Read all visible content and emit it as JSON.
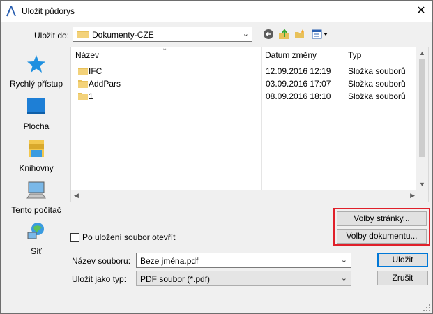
{
  "window": {
    "title": "Uložit půdorys",
    "close_glyph": "✕"
  },
  "toolbar": {
    "save_in_label": "Uložit do:",
    "save_in_value": "Dokumenty-CZE",
    "icons": [
      "back-icon",
      "up-folder-icon",
      "new-folder-icon",
      "view-menu-icon"
    ]
  },
  "places": [
    {
      "label": "Rychlý přístup",
      "icon": "star-icon"
    },
    {
      "label": "Plocha",
      "icon": "desktop-icon"
    },
    {
      "label": "Knihovny",
      "icon": "libraries-icon"
    },
    {
      "label": "Tento počítač",
      "icon": "computer-icon"
    },
    {
      "label": "Síť",
      "icon": "network-icon"
    }
  ],
  "filelist": {
    "columns": [
      "Název",
      "Datum změny",
      "Typ"
    ],
    "rows": [
      {
        "name": "IFC",
        "date": "12.09.2016 12:19",
        "type": "Složka souborů"
      },
      {
        "name": "AddPars",
        "date": "03.09.2016 17:07",
        "type": "Složka souborů"
      },
      {
        "name": "1",
        "date": "08.09.2016 18:10",
        "type": "Složka souborů"
      }
    ]
  },
  "options": {
    "page_options_label": "Volby stránky...",
    "document_options_label": "Volby dokumentu...",
    "open_after_save_label": "Po uložení soubor otevřít",
    "open_after_save_checked": false
  },
  "form": {
    "filename_label": "Název souboru:",
    "filename_value": "Beze jména.pdf",
    "filetype_label": "Uložit jako typ:",
    "filetype_value": "PDF soubor (*.pdf)"
  },
  "buttons": {
    "save": "Uložit",
    "cancel": "Zrušit"
  },
  "colors": {
    "accent": "#0078d7",
    "highlight_box": "#e0202a",
    "folder": "#e8c15a"
  }
}
